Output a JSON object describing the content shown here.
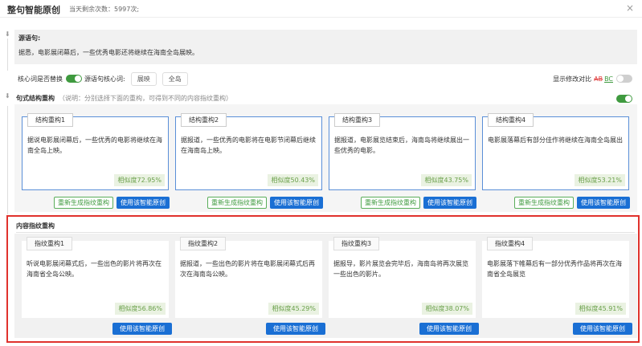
{
  "header": {
    "title": "整句智能原创",
    "remaining": "当天剩余次数：5997次;",
    "close": "×"
  },
  "source": {
    "label": "源语句:",
    "text": "据悉，电影展闭幕后，一些优秀电影还将继续在海南全岛展映。"
  },
  "core": {
    "replace_label": "核心词是否替换",
    "words_label": "源语句核心词:",
    "words": [
      "展映",
      "全岛"
    ],
    "diff_label": "显示修改对比",
    "ab": "AB",
    "bc": "BC"
  },
  "structure": {
    "title": "句式结构重构",
    "note": "（说明：分别选择下面的重构，可得到不同的内容指纹重构）",
    "regen_label": "重新生成指纹重构",
    "use_label": "使用该智能原创",
    "cards": [
      {
        "tab": "结构重构1",
        "text": "据说电影展闭幕后，一些优秀的电影将继续在海南全岛上映。",
        "sim": "相似度72.95%"
      },
      {
        "tab": "结构重构2",
        "text": "据报道，一些优秀的电影将在电影节闭幕后继续在海南岛上映。",
        "sim": "相似度50.43%"
      },
      {
        "tab": "结构重构3",
        "text": "据报道，电影展览结束后，海南岛将继续展出一些优秀的电影。",
        "sim": "相似度43.75%"
      },
      {
        "tab": "结构重构4",
        "text": "电影展落幕后有部分佳作将继续在海南全岛展出",
        "sim": "相似度53.21%"
      }
    ]
  },
  "fingerprint": {
    "title": "内容指纹重构",
    "use_label": "使用该智能原创",
    "cards": [
      {
        "tab": "指纹重构1",
        "text": "听说电影展闭幕式后，一些出色的影片将再次在海南省全岛公映。",
        "sim": "相似度56.86%"
      },
      {
        "tab": "指纹重构2",
        "text": "据报道，一些出色的影片将在电影展闭幕式后再次在海南岛公映。",
        "sim": "相似度45.29%"
      },
      {
        "tab": "指纹重构3",
        "text": "据报导，影片展览会完毕后，海南岛将再次展览一些出色的影片。",
        "sim": "相似度38.07%"
      },
      {
        "tab": "指纹重构4",
        "text": "电影展落下帷幕后有一部分优秀作品将再次在海南省全岛展览",
        "sim": "相似度45.91%"
      }
    ]
  },
  "colors": {
    "accent_blue": "#1a6fd4",
    "accent_green": "#3f9a3f",
    "highlight_red": "#e0322d"
  }
}
